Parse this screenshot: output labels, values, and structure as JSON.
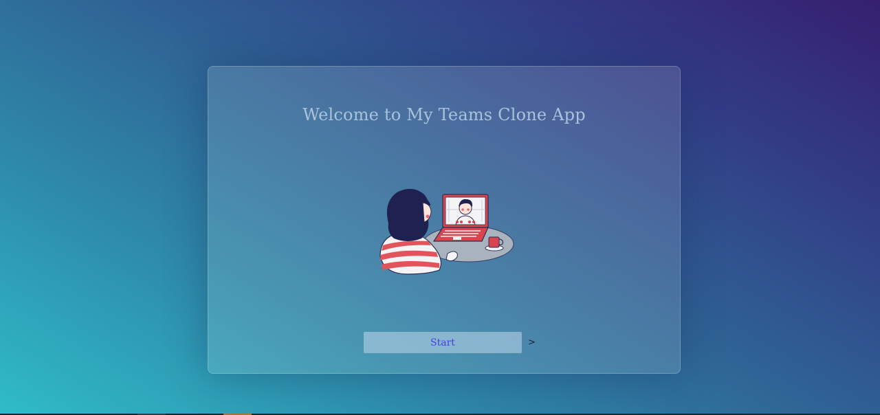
{
  "welcome": {
    "title": "Welcome to My Teams Clone App",
    "illustration": "woman-video-call-illustration"
  },
  "actions": {
    "start_label": "Start",
    "arrow": ">"
  },
  "colors": {
    "title": "#a9c3dc",
    "button_text": "#4b3ce6",
    "laptop": "#d9454f",
    "hair": "#1f2150"
  }
}
